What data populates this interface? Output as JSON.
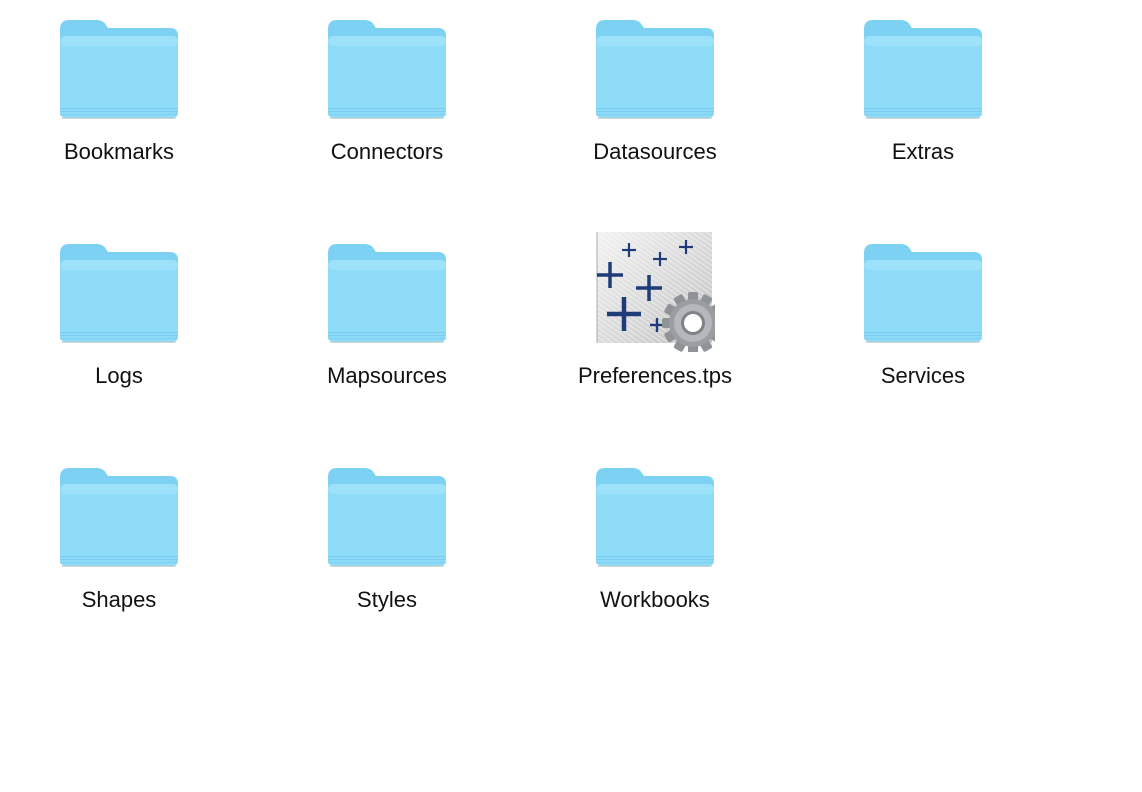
{
  "items": [
    {
      "name": "Bookmarks",
      "kind": "folder",
      "icon": "folder-icon"
    },
    {
      "name": "Connectors",
      "kind": "folder",
      "icon": "folder-icon"
    },
    {
      "name": "Datasources",
      "kind": "folder",
      "icon": "folder-icon"
    },
    {
      "name": "Extras",
      "kind": "folder",
      "icon": "folder-icon"
    },
    {
      "name": "Logs",
      "kind": "folder",
      "icon": "folder-icon"
    },
    {
      "name": "Mapsources",
      "kind": "folder",
      "icon": "folder-icon"
    },
    {
      "name": "Preferences.tps",
      "kind": "file",
      "icon": "tableau-preferences-file-icon"
    },
    {
      "name": "Services",
      "kind": "folder",
      "icon": "folder-icon"
    },
    {
      "name": "Shapes",
      "kind": "folder",
      "icon": "folder-icon"
    },
    {
      "name": "Styles",
      "kind": "folder",
      "icon": "folder-icon"
    },
    {
      "name": "Workbooks",
      "kind": "folder",
      "icon": "folder-icon"
    }
  ],
  "colors": {
    "folder_body": "#8fdcf8",
    "folder_tab": "#7dd2f4",
    "folder_edge": "#6fc6ec",
    "tableau_plus": "#1f3c78",
    "gear": "#8f9296"
  }
}
